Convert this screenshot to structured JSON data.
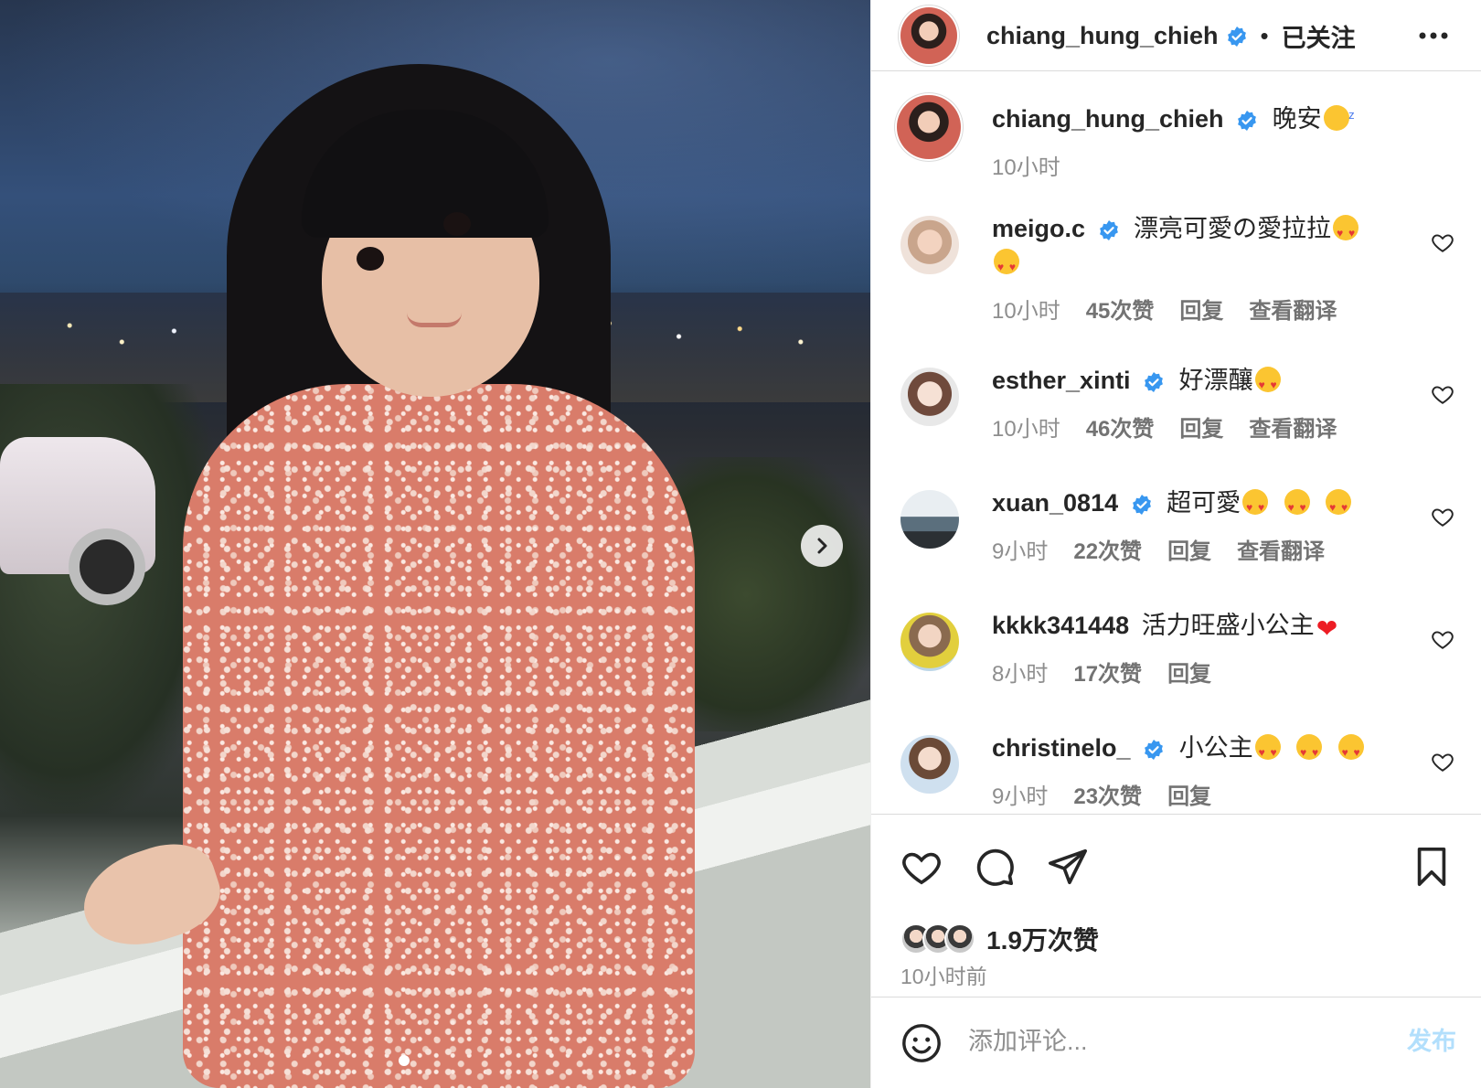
{
  "photo": {
    "next_icon": "chevron-right-icon",
    "carousel_dots": 1
  },
  "header": {
    "username": "chiang_hung_chieh",
    "separator": "•",
    "follow_status": "已关注",
    "more_icon": "more-horizontal-icon"
  },
  "caption": {
    "username": "chiang_hung_chieh",
    "text": "晚安",
    "time": "10小时"
  },
  "comments": [
    {
      "username": "meigo.c",
      "text": "漂亮可愛の愛拉拉",
      "time": "10小时",
      "likes": "45次赞",
      "reply": "回复",
      "translate": "查看翻译"
    },
    {
      "username": "esther_xinti",
      "text": "好漂釀",
      "time": "10小时",
      "likes": "46次赞",
      "reply": "回复",
      "translate": "查看翻译"
    },
    {
      "username": "xuan_0814",
      "text": "超可愛",
      "time": "9小时",
      "likes": "22次赞",
      "reply": "回复",
      "translate": "查看翻译"
    },
    {
      "username": "kkkk341448",
      "text": "活力旺盛小公主",
      "time": "8小时",
      "likes": "17次赞",
      "reply": "回复",
      "translate": ""
    },
    {
      "username": "christinelo_",
      "text": "小公主",
      "time": "9小时",
      "likes": "23次赞",
      "reply": "回复",
      "translate": ""
    }
  ],
  "actions": {
    "like_icon": "heart-icon",
    "comment_icon": "comment-icon",
    "share_icon": "send-icon",
    "save_icon": "bookmark-icon",
    "likes": "1.9万次赞",
    "time_ago": "10小时前"
  },
  "composer": {
    "emoji_icon": "smiley-icon",
    "placeholder": "添加评论...",
    "post_label": "发布"
  },
  "colors": {
    "verified": "#3897f0",
    "post_disabled": "#b2dffc",
    "muted": "#8e8e8e"
  }
}
